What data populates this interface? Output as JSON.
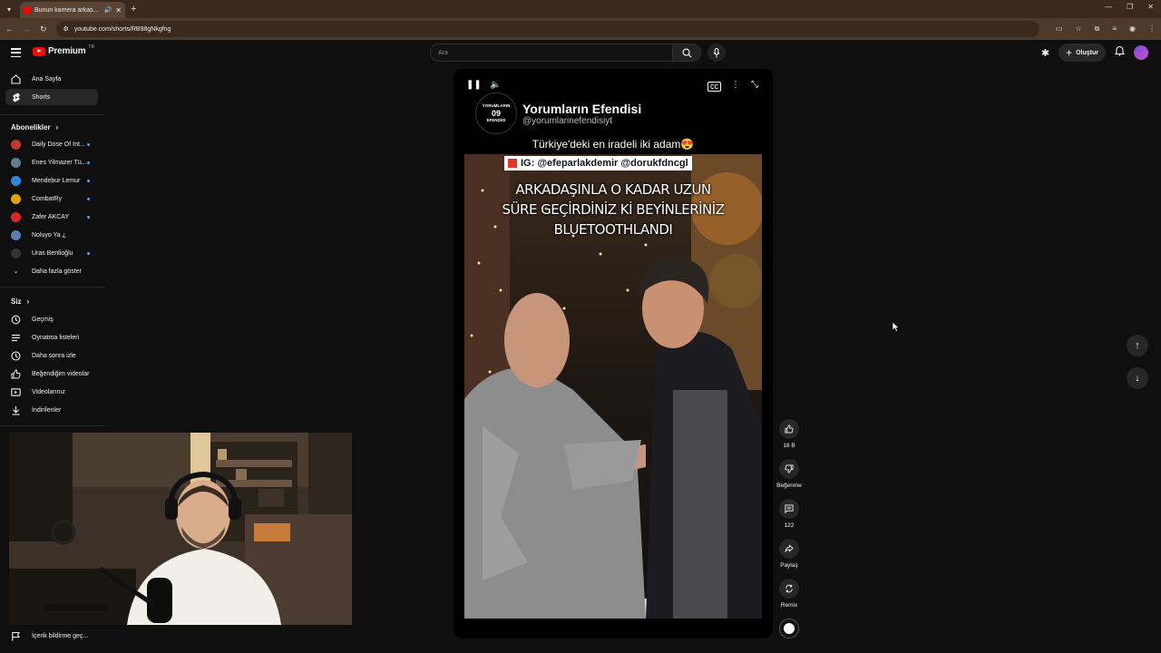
{
  "browser": {
    "tab_title": "Bunun kamera arkasını izle",
    "url": "youtube.com/shorts/RB98gNkgfng"
  },
  "header": {
    "logo_text": "Premium",
    "logo_superscript": "TR",
    "search_placeholder": "Ara",
    "create_label": "Oluştur"
  },
  "sidebar": {
    "main": [
      {
        "label": "Ana Sayfa",
        "icon": "home-icon"
      },
      {
        "label": "Shorts",
        "icon": "shorts-icon"
      }
    ],
    "subscriptions_title": "Abonelikler",
    "subscriptions": [
      {
        "label": "Daily Dose Of Int...",
        "color": "#c0392b"
      },
      {
        "label": "Enes Yilmazer Tü...",
        "color": "#607d8b"
      },
      {
        "label": "Mendebur Lemur",
        "color": "#2e86de"
      },
      {
        "label": "CombatRy",
        "color": "#e1a400"
      },
      {
        "label": "Zafer AKCAY",
        "color": "#d62828"
      },
      {
        "label": "Noluyo Ya ¿",
        "color": "#5b7db1"
      },
      {
        "label": "Uras Benlioğlu",
        "color": "#333333"
      }
    ],
    "show_more": "Daha fazla göster",
    "you_title": "Siz",
    "you_items": [
      {
        "label": "Geçmiş",
        "icon": "history-icon"
      },
      {
        "label": "Oynatma listeleri",
        "icon": "playlist-icon"
      },
      {
        "label": "Daha sonra izle",
        "icon": "clock-icon"
      },
      {
        "label": "Beğendiğim videolar",
        "icon": "thumbs-up-icon"
      },
      {
        "label": "Videolarınız",
        "icon": "video-icon"
      },
      {
        "label": "İndirilenler",
        "icon": "download-icon"
      }
    ],
    "report_label": "İçerik bildirme geç..."
  },
  "video": {
    "channel_logo_line1": "YORUMLARIN",
    "channel_logo_line2": "09",
    "channel_logo_line3": "EFENDİSİ",
    "channel_name": "Yorumların Efendisi",
    "channel_handle": "@yorumlarinefendisiyt",
    "caption": "Türkiye'deki en iradeli iki adam😍",
    "ig_text": "IG: @efeparlakdemir @dorukfdncgl",
    "overlay_lines": [
      "ARKADAŞINLA O KADAR UZUN",
      "SÜRE GEÇİRDİNİZ Kİ BEYİNLERİNİZ",
      "BLUETOOTHLANDI"
    ]
  },
  "actions": {
    "likes": "18 B",
    "dislike": "Beğenme",
    "comments": "122",
    "share": "Paylaş",
    "remix": "Remix"
  }
}
